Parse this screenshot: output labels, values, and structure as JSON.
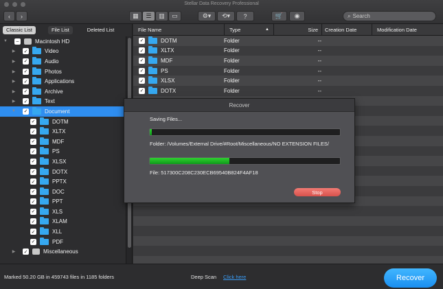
{
  "window": {
    "title": "Stellar Data Recovery Professional"
  },
  "search": {
    "placeholder": "Search"
  },
  "toolbar": {
    "back_icon": "chevron-left-icon",
    "forward_icon": "chevron-right-icon",
    "view_grid": "grid-view-icon",
    "view_list": "list-view-icon",
    "view_columns": "column-view-icon",
    "view_cover": "cover-flow-icon",
    "settings": "gear-icon",
    "history": "history-icon",
    "help_label": "?",
    "cart": "cart-icon",
    "account": "user-icon"
  },
  "left_tabs": [
    "Classic List",
    "File List",
    "Deleted List"
  ],
  "tree": [
    {
      "label": "Macintosh HD",
      "icon": "drive-icon",
      "arrow": "▼",
      "indent": 0
    },
    {
      "label": "Video",
      "icon": "folder-icon",
      "arrow": "▶",
      "indent": 1
    },
    {
      "label": "Audio",
      "icon": "folder-icon",
      "arrow": "▶",
      "indent": 1
    },
    {
      "label": "Photos",
      "icon": "folder-icon",
      "arrow": "▶",
      "indent": 1
    },
    {
      "label": "Applications",
      "icon": "folder-icon",
      "arrow": "▶",
      "indent": 1
    },
    {
      "label": "Archive",
      "icon": "folder-icon",
      "arrow": "▶",
      "indent": 1
    },
    {
      "label": "Text",
      "icon": "folder-icon",
      "arrow": "▶",
      "indent": 1
    },
    {
      "label": "Document",
      "icon": "folder-icon",
      "arrow": "▼",
      "indent": 1,
      "selected": true
    },
    {
      "label": "DOTM",
      "icon": "folder-icon",
      "arrow": "",
      "indent": 2
    },
    {
      "label": "XLTX",
      "icon": "folder-icon",
      "arrow": "",
      "indent": 2
    },
    {
      "label": "MDF",
      "icon": "folder-icon",
      "arrow": "",
      "indent": 2
    },
    {
      "label": "PS",
      "icon": "folder-icon",
      "arrow": "",
      "indent": 2
    },
    {
      "label": "XLSX",
      "icon": "folder-icon",
      "arrow": "",
      "indent": 2
    },
    {
      "label": "DOTX",
      "icon": "folder-icon",
      "arrow": "",
      "indent": 2
    },
    {
      "label": "PPTX",
      "icon": "folder-icon",
      "arrow": "",
      "indent": 2
    },
    {
      "label": "DOC",
      "icon": "folder-icon",
      "arrow": "",
      "indent": 2
    },
    {
      "label": "PPT",
      "icon": "folder-icon",
      "arrow": "",
      "indent": 2
    },
    {
      "label": "XLS",
      "icon": "folder-icon",
      "arrow": "",
      "indent": 2
    },
    {
      "label": "XLAM",
      "icon": "folder-icon",
      "arrow": "",
      "indent": 2
    },
    {
      "label": "XLL",
      "icon": "folder-icon",
      "arrow": "",
      "indent": 2
    },
    {
      "label": "PDF",
      "icon": "folder-icon",
      "arrow": "",
      "indent": 2
    },
    {
      "label": "Miscellaneous",
      "icon": "drive-icon",
      "arrow": "▶",
      "indent": 1
    }
  ],
  "columns": [
    "File Name",
    "Type",
    "Size",
    "Creation Date",
    "Modification Date"
  ],
  "sort_indicator": "▲",
  "rows": [
    {
      "name": "DOTM",
      "type": "Folder",
      "size": "--"
    },
    {
      "name": "XLTX",
      "type": "Folder",
      "size": "--"
    },
    {
      "name": "MDF",
      "type": "Folder",
      "size": "--"
    },
    {
      "name": "PS",
      "type": "Folder",
      "size": "--"
    },
    {
      "name": "XLSX",
      "type": "Folder",
      "size": "--"
    },
    {
      "name": "DOTX",
      "type": "Folder",
      "size": "--"
    }
  ],
  "status": {
    "marked": "Marked 50.20 GB in 459743 files in 1185 folders",
    "deep_scan_label": "Deep Scan",
    "deep_scan_link": "Click here"
  },
  "recover_button": "Recover",
  "dialog": {
    "title": "Recover",
    "saving_label": "Saving Files...",
    "progress_overall": 0.01,
    "folder_label": "Folder: /Volumes/External Drive/#Root/Miscellaneous/NO EXTENSION FILES/",
    "progress_file": 0.42,
    "file_label": "File: 517300C208C230ECB69540B824F4AF18",
    "stop_label": "Stop"
  },
  "colors": {
    "accent": "#2f8ef0",
    "progress": "#1fb627",
    "stop": "#e0605a"
  }
}
